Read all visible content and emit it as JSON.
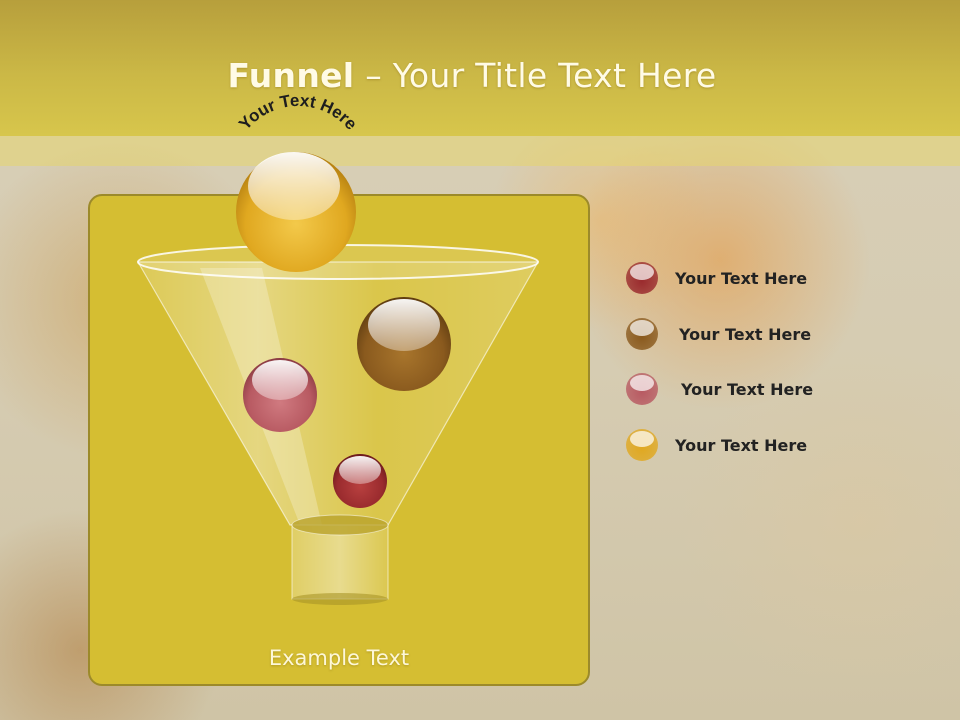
{
  "slide": {
    "title_bold": "Funnel",
    "title_rest": " – Your Title Text Here",
    "arc_text": "Your Text Here",
    "example_text": "Example Text"
  },
  "legend": [
    {
      "label": "Your  Text Here",
      "color": "#9a2b2e"
    },
    {
      "label": "Your  Text Here",
      "color": "#8a5a1e"
    },
    {
      "label": "Your  Text Here",
      "color": "#b85a62"
    },
    {
      "label": "Your  Text Here",
      "color": "#e0a820"
    }
  ],
  "colors": {
    "header": "#cbb846",
    "panel": "#d5be32",
    "panel_border": "#9c8a2a",
    "ball_gold": "#e0a820",
    "ball_brown": "#8a5a1e",
    "ball_rose": "#b85a62",
    "ball_crimson": "#9a2b2e"
  }
}
